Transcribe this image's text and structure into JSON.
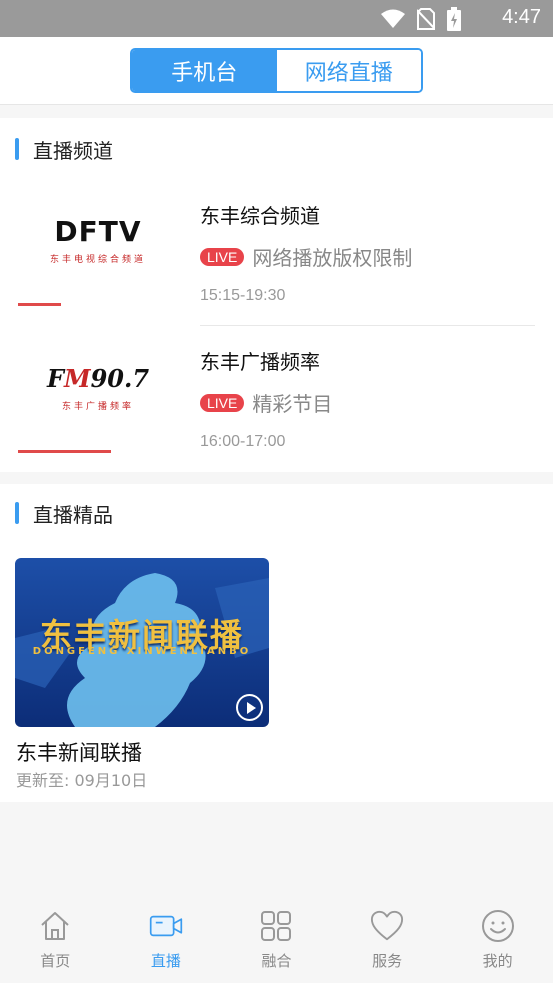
{
  "status_bar": {
    "time": "4:47"
  },
  "header": {
    "tabs": [
      {
        "label": "手机台",
        "active": true
      },
      {
        "label": "网络直播",
        "active": false
      }
    ]
  },
  "live_channels": {
    "title": "直播频道",
    "items": [
      {
        "logo_text": "DFTV",
        "logo_sub": "东丰电视综合频道",
        "name": "东丰综合频道",
        "badge": "LIVE",
        "status": "网络播放版权限制",
        "time": "15:15-19:30"
      },
      {
        "logo_text_a": "F",
        "logo_text_b": "M",
        "logo_text_c": "90.7",
        "logo_sub": "东丰广播频率",
        "name": "东丰广播频率",
        "badge": "LIVE",
        "status": "精彩节目",
        "time": "16:00-17:00"
      }
    ]
  },
  "featured": {
    "title": "直播精品",
    "items": [
      {
        "thumb_title": "东丰新闻联播",
        "thumb_sub": "DONGFENG XINWENLIANBO",
        "name": "东丰新闻联播",
        "update": "更新至: 09月10日"
      }
    ]
  },
  "bottom_nav": [
    {
      "label": "首页",
      "icon": "home-icon",
      "active": false
    },
    {
      "label": "直播",
      "icon": "video-camera-icon",
      "active": true
    },
    {
      "label": "融合",
      "icon": "grid-icon",
      "active": false
    },
    {
      "label": "服务",
      "icon": "heart-icon",
      "active": false
    },
    {
      "label": "我的",
      "icon": "smiley-icon",
      "active": false
    }
  ],
  "colors": {
    "accent": "#3a9cf0",
    "live_red": "#e8434a"
  }
}
